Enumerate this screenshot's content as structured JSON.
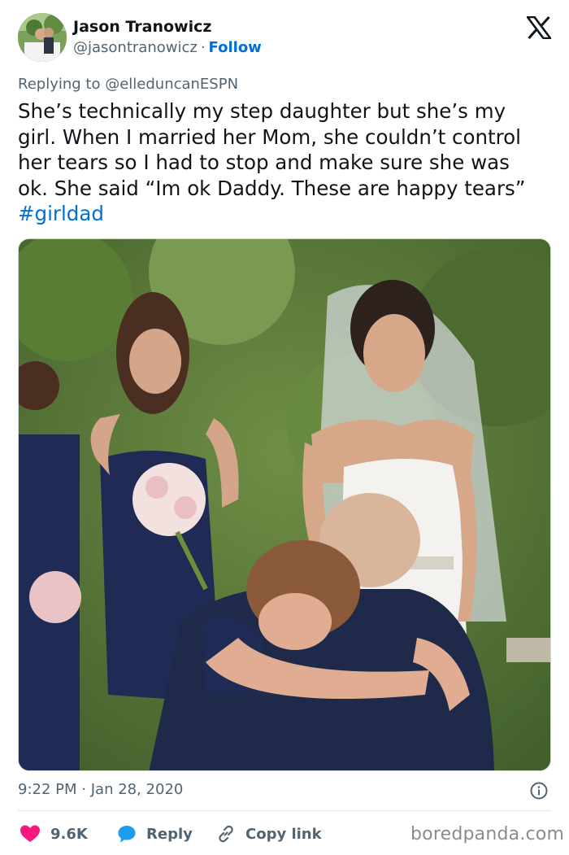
{
  "author": {
    "name": "Jason Tranowicz",
    "handle": "@jasontranowicz",
    "separator": "·",
    "follow_label": "Follow"
  },
  "reply": {
    "prefix": "Replying to ",
    "target": "@elleduncanESPN"
  },
  "tweet": {
    "lines": [
      "She’s technically my step daughter but she’s my",
      "girl. When I married her Mom, she couldn’t control",
      "her tears so I had to stop and make sure she was",
      "ok. She said “Im ok Daddy. These are happy tears”"
    ],
    "hashtag": "#girldad"
  },
  "meta": {
    "time": "9:22 PM",
    "separator": "·",
    "date": "Jan 28, 2020"
  },
  "actions": {
    "likes": "9.6K",
    "reply_label": "Reply",
    "copy_link_label": "Copy link"
  },
  "watermark": "boredpanda.com",
  "icons": {
    "logo": "x-logo-icon",
    "info": "info-icon",
    "like": "heart-icon",
    "reply": "speech-bubble-icon",
    "link": "link-icon"
  },
  "colors": {
    "link_blue": "#006fd6",
    "heart_red": "#f91880",
    "reply_blue": "#1d9bf0",
    "secondary_text": "#536471"
  }
}
